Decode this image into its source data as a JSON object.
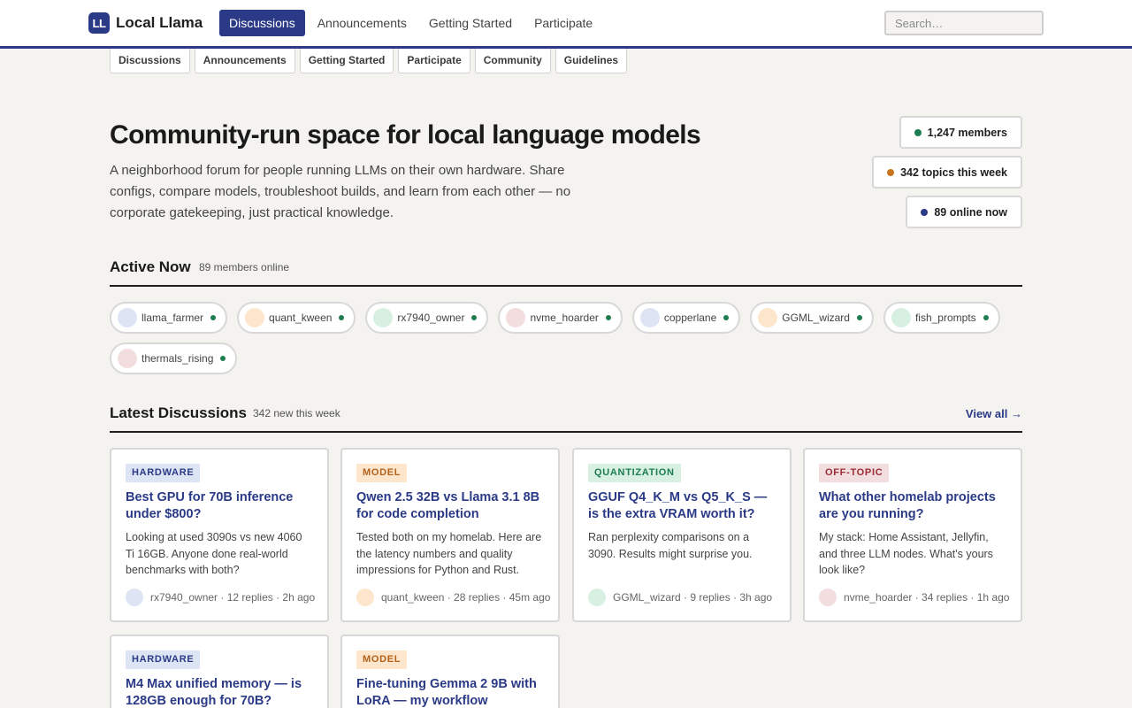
{
  "brand": {
    "mark": "LL",
    "name": "Local Llama"
  },
  "nav": [
    {
      "label": "Discussions",
      "active": true
    },
    {
      "label": "Announcements",
      "active": false
    },
    {
      "label": "Getting Started",
      "active": false
    },
    {
      "label": "Participate",
      "active": false
    }
  ],
  "search": {
    "placeholder": "Search…",
    "value": ""
  },
  "subnav": [
    "Discussions",
    "Announcements",
    "Getting Started",
    "Participate",
    "Community",
    "Guidelines"
  ],
  "hero": {
    "title": "Community-run space for local language models",
    "description": "A neighborhood forum for people running LLMs on their own hardware. Share configs, compare models, troubleshoot builds, and learn from each other — no corporate gatekeeping, just practical knowledge."
  },
  "stats": [
    {
      "label": "1,247 members",
      "color": "#1e7d4e"
    },
    {
      "label": "342 topics this week",
      "color": "#c8761c"
    },
    {
      "label": "89 online now",
      "color": "#2b3a86"
    }
  ],
  "active_now": {
    "title": "Active Now",
    "subtitle": "89 members online",
    "members": [
      {
        "name": "llama_farmer",
        "avatar_color": "#dde5f5"
      },
      {
        "name": "quant_kween",
        "avatar_color": "#fde6cc"
      },
      {
        "name": "rx7940_owner",
        "avatar_color": "#d7f0e2"
      },
      {
        "name": "nvme_hoarder",
        "avatar_color": "#f2dedf"
      },
      {
        "name": "copperlane",
        "avatar_color": "#dde5f5"
      },
      {
        "name": "GGML_wizard",
        "avatar_color": "#fde6cc"
      },
      {
        "name": "fish_prompts",
        "avatar_color": "#d7f0e2"
      },
      {
        "name": "thermals_rising",
        "avatar_color": "#f2dedf"
      }
    ]
  },
  "latest": {
    "title": "Latest Discussions",
    "subtitle": "342 new this week",
    "view_all": "View all",
    "view_all_icon": "→",
    "cards": [
      {
        "tag": "HARDWARE",
        "tag_bg": "#dde5f5",
        "tag_fg": "#2b3a86",
        "title": "Best GPU for 70B inference under $800?",
        "excerpt": "Looking at used 3090s vs new 4060 Ti 16GB. Anyone done real-world benchmarks with both?",
        "meta": "rx7940_owner · 12 replies · 2h ago",
        "avatar_color": "#dde5f5"
      },
      {
        "tag": "MODEL",
        "tag_bg": "#fde6cc",
        "tag_fg": "#b3611a",
        "title": "Qwen 2.5 32B vs Llama 3.1 8B for code completion",
        "excerpt": "Tested both on my homelab. Here are the latency numbers and quality impressions for Python and Rust.",
        "meta": "quant_kween · 28 replies · 45m ago",
        "avatar_color": "#fde6cc"
      },
      {
        "tag": "QUANTIZATION",
        "tag_bg": "#d7f0e2",
        "tag_fg": "#1e7d4e",
        "title": "GGUF Q4_K_M vs Q5_K_S — is the extra VRAM worth it?",
        "excerpt": "Ran perplexity comparisons on a 3090. Results might surprise you.",
        "meta": "GGML_wizard · 9 replies · 3h ago",
        "avatar_color": "#d7f0e2"
      },
      {
        "tag": "OFF-TOPIC",
        "tag_bg": "#f2dedf",
        "tag_fg": "#9b2c35",
        "title": "What other homelab projects are you running?",
        "excerpt": "My stack: Home Assistant, Jellyfin, and three LLM nodes. What's yours look like?",
        "meta": "nvme_hoarder · 34 replies · 1h ago",
        "avatar_color": "#f2dedf"
      },
      {
        "tag": "HARDWARE",
        "tag_bg": "#dde5f5",
        "tag_fg": "#2b3a86",
        "title": "M4 Max unified memory — is 128GB enough for 70B?",
        "excerpt": "",
        "meta": "",
        "avatar_color": "#dde5f5"
      },
      {
        "tag": "MODEL",
        "tag_bg": "#fde6cc",
        "tag_fg": "#b3611a",
        "title": "Fine-tuning Gemma 2 9B with LoRA — my workflow",
        "excerpt": "",
        "meta": "",
        "avatar_color": "#fde6cc"
      }
    ]
  }
}
